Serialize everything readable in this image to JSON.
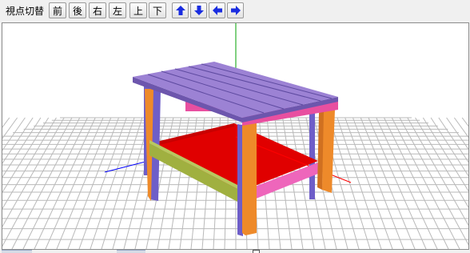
{
  "toolbar": {
    "label": "視点切替",
    "buttons": [
      {
        "label": "前"
      },
      {
        "label": "後"
      },
      {
        "label": "右"
      },
      {
        "label": "左"
      },
      {
        "label": "上"
      },
      {
        "label": "下"
      }
    ],
    "arrow_buttons": [
      {
        "icon": "arrow-up-icon"
      },
      {
        "icon": "arrow-down-icon"
      },
      {
        "icon": "arrow-left-icon"
      },
      {
        "icon": "arrow-right-icon"
      }
    ]
  },
  "viewport": {
    "axes": {
      "x": "#ff0000",
      "y": "#00a000",
      "z": "#0000ff"
    },
    "colors": {
      "top_slats": "#9c82d4",
      "apron": "#e84fa0",
      "lower_shelf": "#e00000",
      "lower_rail_front": "#a0b040",
      "lower_rail_side": "#ee66bb",
      "legs_front": "#ee8a2a",
      "legs_side": "#6e5ec8",
      "grid_line": "#b8b8b8"
    }
  }
}
